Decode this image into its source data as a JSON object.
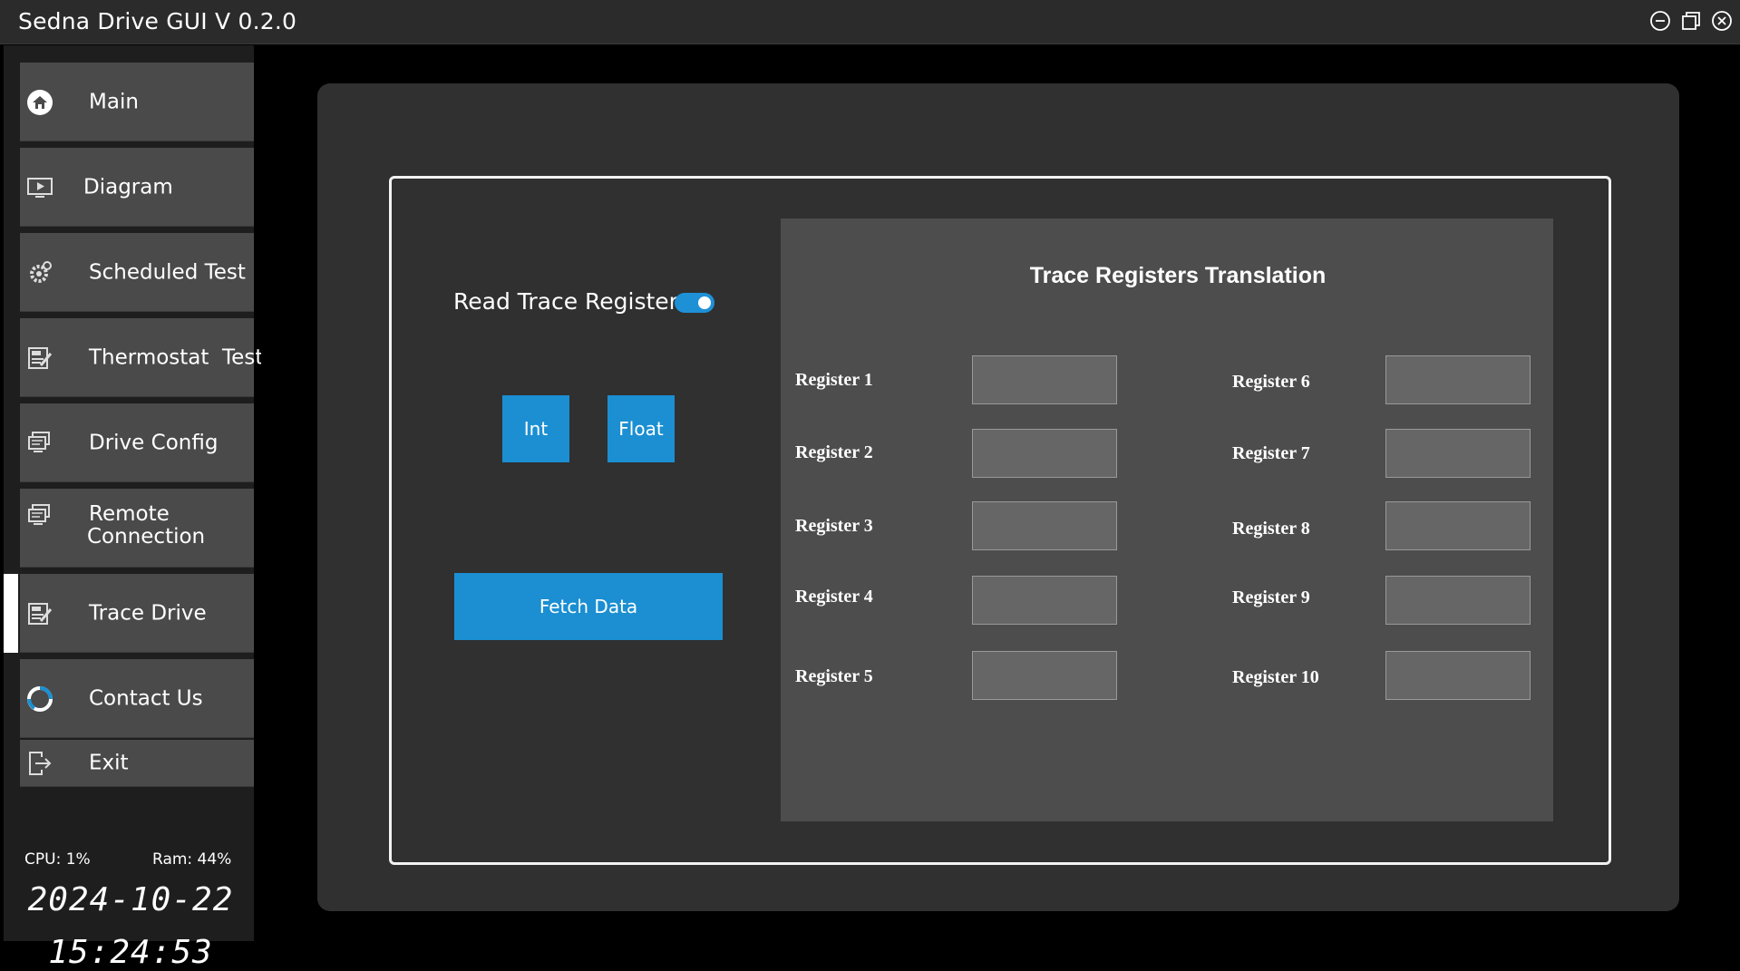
{
  "window": {
    "title": "Sedna Drive GUI V 0.2.0",
    "controls": [
      "minimize-icon",
      "restore-icon",
      "close-icon"
    ]
  },
  "sidebar": {
    "items": [
      {
        "label": "Main",
        "icon": "home-icon"
      },
      {
        "label": "Diagram",
        "icon": "monitor-play-icon"
      },
      {
        "label": "Scheduled Test",
        "icon": "gear-icon"
      },
      {
        "label": "Thermostat  Test",
        "icon": "test-pen-icon"
      },
      {
        "label": "Drive Config",
        "icon": "monitor-stack-icon"
      },
      {
        "label": "Remote",
        "label2": "Connection",
        "icon": "monitor-stack-icon"
      },
      {
        "label": "Trace Drive",
        "icon": "test-pen-icon",
        "active": true
      },
      {
        "label": "Contact Us",
        "icon": "ring-icon"
      },
      {
        "label": "Exit",
        "icon": "exit-icon"
      }
    ],
    "cpu": "CPU: 1%",
    "ram": "Ram: 44%",
    "date": "2024-10-22",
    "time": "15:24:53"
  },
  "trace": {
    "toggle_label": "Read Trace Registers",
    "toggle_on": true,
    "int_label": "Int",
    "float_label": "Float",
    "fetch_label": "Fetch Data",
    "panel_title": "Trace Registers Translation",
    "registers_left": [
      "Register 1",
      "Register 2",
      "Register 3",
      "Register 4",
      "Register 5"
    ],
    "registers_right": [
      "Register 6",
      "Register 7",
      "Register 8",
      "Register 9",
      "Register 10"
    ]
  },
  "colors": {
    "accent": "#1b8fd2",
    "nav_bg": "#4a4a4a",
    "panel_bg": "#303030"
  }
}
